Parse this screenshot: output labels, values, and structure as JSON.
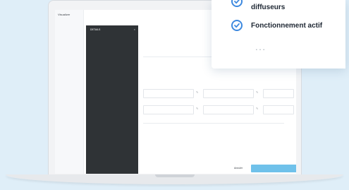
{
  "app": {
    "logo": "Visualizer",
    "sidebar": {
      "items": [
        "",
        "",
        ""
      ]
    }
  },
  "drawer": {
    "title": "DETAILS",
    "close_icon": "close-icon",
    "sections": [
      {
        "label": "",
        "text": ""
      },
      {
        "label": "",
        "text": ""
      },
      {
        "label": "",
        "text": ""
      },
      {
        "label": "",
        "text": ""
      },
      {
        "label": "",
        "text": ""
      },
      {
        "label": "",
        "text": ""
      }
    ]
  },
  "form": {
    "title": "",
    "subtitle": "",
    "section_heading": "",
    "fields": [
      {
        "label": "",
        "value": ""
      },
      {
        "label": "",
        "value": ""
      },
      {
        "label": "",
        "value": ""
      },
      {
        "label": "",
        "value": ""
      },
      {
        "label": "",
        "value": ""
      },
      {
        "label": "",
        "value": ""
      },
      {
        "label": "",
        "value": ""
      },
      {
        "label": "",
        "value": ""
      }
    ],
    "note_label": "",
    "note_value": "",
    "cancel_label": "Annuler",
    "save_label": ""
  },
  "card": {
    "feature_1": "diffuseurs",
    "feature_2": "Fonctionnement actif",
    "icon_color": "#3d89df"
  }
}
